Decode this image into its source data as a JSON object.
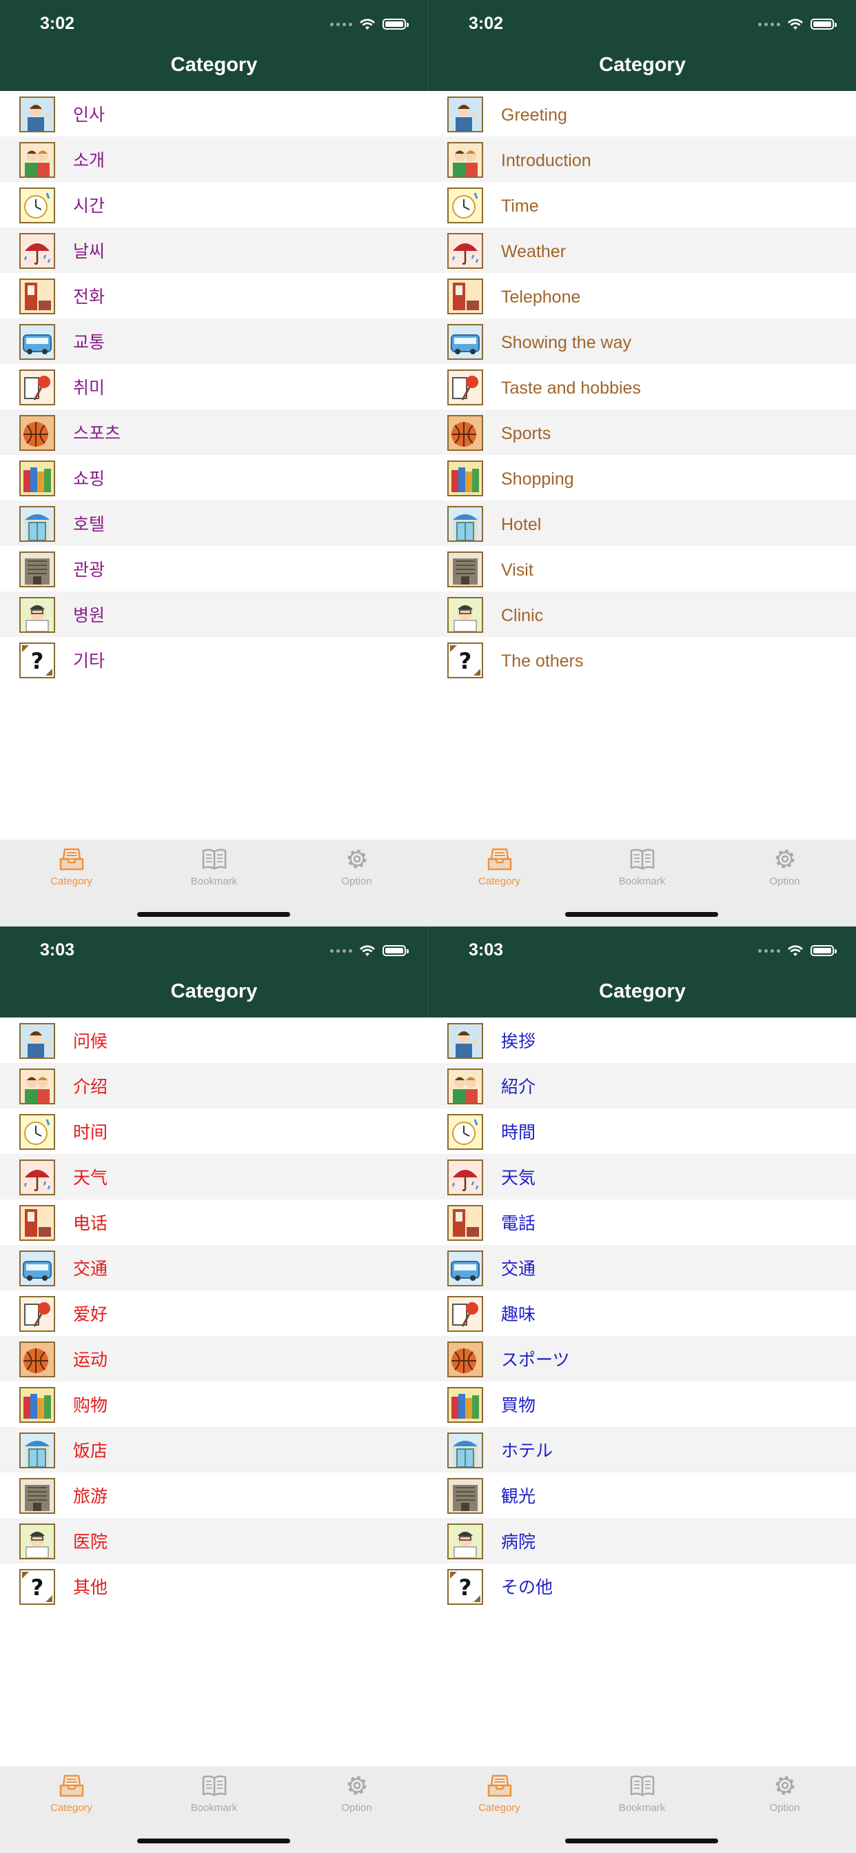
{
  "colors": {
    "header_bg": "#1b4739",
    "tab_active": "#f0923a",
    "tab_inactive": "#a8a8a8"
  },
  "icons": [
    "greeting-icon",
    "introduction-icon",
    "time-icon",
    "weather-icon",
    "telephone-icon",
    "transport-icon",
    "hobby-icon",
    "sports-icon",
    "shopping-icon",
    "hotel-icon",
    "sightseeing-icon",
    "clinic-icon",
    "others-icon"
  ],
  "tabs": {
    "category": "Category",
    "bookmark": "Bookmark",
    "option": "Option"
  },
  "screens": [
    {
      "time": "3:02",
      "title": "Category",
      "text_color": "#8a1a8a",
      "items": [
        "인사",
        "소개",
        "시간",
        "날씨",
        "전화",
        "교통",
        "취미",
        "스포츠",
        "쇼핑",
        "호텔",
        "관광",
        "병원",
        "기타"
      ]
    },
    {
      "time": "3:02",
      "title": "Category",
      "text_color": "#a0642a",
      "items": [
        "Greeting",
        "Introduction",
        "Time",
        "Weather",
        "Telephone",
        "Showing the way",
        "Taste and hobbies",
        "Sports",
        "Shopping",
        "Hotel",
        "Visit",
        "Clinic",
        "The others"
      ]
    },
    {
      "time": "3:03",
      "title": "Category",
      "text_color": "#e51b1b",
      "items": [
        "问候",
        "介绍",
        "时间",
        "天气",
        "电话",
        "交通",
        "爱好",
        "运动",
        "购物",
        "饭店",
        "旅游",
        "医院",
        "其他"
      ]
    },
    {
      "time": "3:03",
      "title": "Category",
      "text_color": "#1e1ec8",
      "items": [
        "挨拶",
        "紹介",
        "時間",
        "天気",
        "電話",
        "交通",
        "趣味",
        "スポーツ",
        "買物",
        "ホテル",
        "観光",
        "病院",
        "その他"
      ]
    }
  ]
}
